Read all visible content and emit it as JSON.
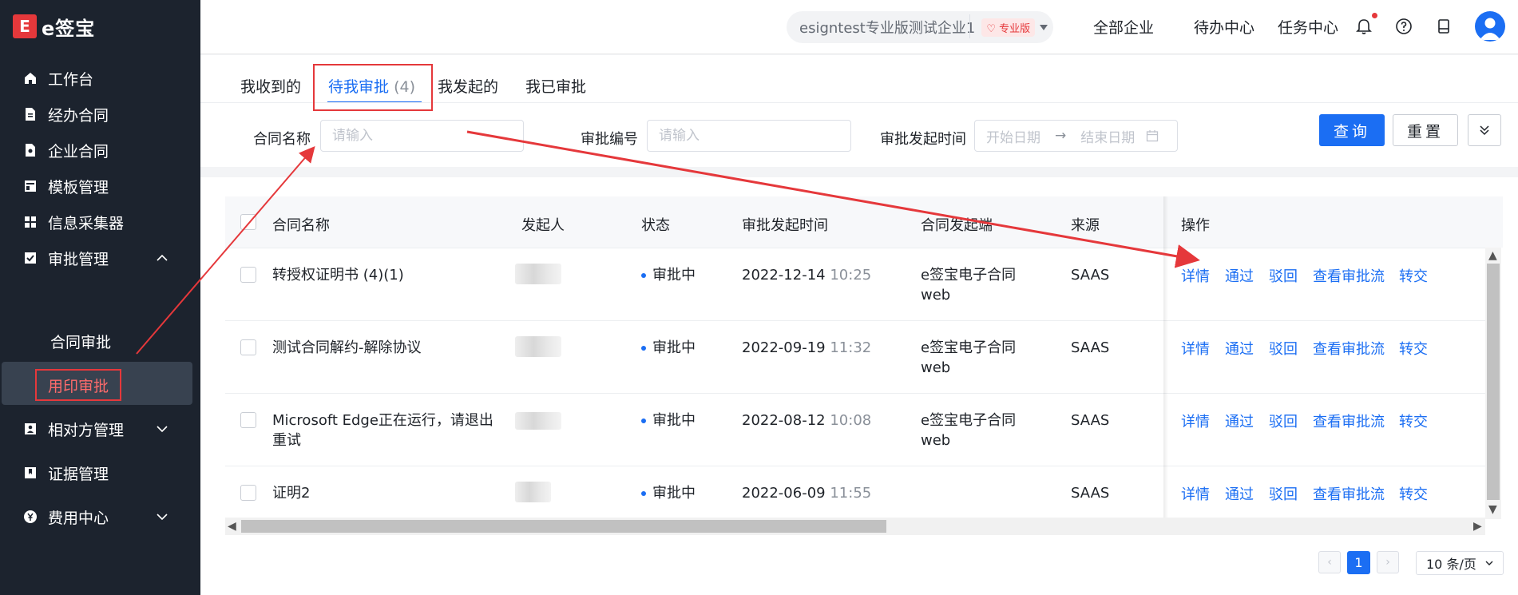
{
  "app": {
    "logo_mark": "E",
    "logo_text": "e签宝"
  },
  "sidebar": {
    "items": [
      {
        "label": "工作台",
        "icon": "home-icon"
      },
      {
        "label": "经办合同",
        "icon": "document-icon"
      },
      {
        "label": "企业合同",
        "icon": "enterprise-doc-icon"
      },
      {
        "label": "模板管理",
        "icon": "template-icon"
      },
      {
        "label": "信息采集器",
        "icon": "grid-icon"
      },
      {
        "label": "审批管理",
        "icon": "approval-icon",
        "expanded": true
      },
      {
        "label": "相对方管理",
        "icon": "contacts-icon"
      },
      {
        "label": "证据管理",
        "icon": "bookmark-icon"
      },
      {
        "label": "费用中心",
        "icon": "yuan-icon"
      }
    ],
    "sub_items": [
      "合同审批",
      "用印审批"
    ]
  },
  "topbar": {
    "enterprise": "esigntest专业版测试企业1",
    "badge": "专业版",
    "links": [
      "全部企业",
      "待办中心",
      "任务中心"
    ]
  },
  "tabs": {
    "received": "我收到的",
    "pending": "待我审批",
    "pending_count": "(4)",
    "initiated": "我发起的",
    "approved": "我已审批"
  },
  "filters": {
    "contract_name_label": "合同名称",
    "contract_name_placeholder": "请输入",
    "approval_no_label": "审批编号",
    "approval_no_placeholder": "请输入",
    "time_label": "审批发起时间",
    "start_placeholder": "开始日期",
    "end_placeholder": "结束日期",
    "query_button": "查询",
    "reset_button": "重置"
  },
  "table": {
    "headers": [
      "合同名称",
      "发起人",
      "状态",
      "审批发起时间",
      "合同发起端",
      "来源",
      "操作"
    ],
    "actions": [
      "详情",
      "通过",
      "驳回",
      "查看审批流",
      "转交"
    ],
    "rows": [
      {
        "name": "转授权证明书 (4)(1)",
        "status": "审批中",
        "date": "2022-12-14",
        "time": "10:25",
        "origin": "e签宝电子合同",
        "origin2": "web",
        "source": "SAAS"
      },
      {
        "name": "测试合同解约-解除协议",
        "status": "审批中",
        "date": "2022-09-19",
        "time": "11:32",
        "origin": "e签宝电子合同",
        "origin2": "web",
        "source": "SAAS"
      },
      {
        "name": "Microsoft Edge正在运行，请退出",
        "name2": "重试",
        "status": "审批中",
        "date": "2022-08-12",
        "time": "10:08",
        "origin": "e签宝电子合同",
        "origin2": "web",
        "source": "SAAS"
      },
      {
        "name": "证明2",
        "status": "审批中",
        "date": "2022-06-09",
        "time": "11:55",
        "origin": "",
        "origin2": "",
        "source": "SAAS"
      }
    ]
  },
  "pagination": {
    "current": "1",
    "page_size": "10 条/页"
  },
  "colors": {
    "primary": "#1b6ef3",
    "sidebar_bg": "#1c232e",
    "highlight_red": "#e5383b"
  }
}
